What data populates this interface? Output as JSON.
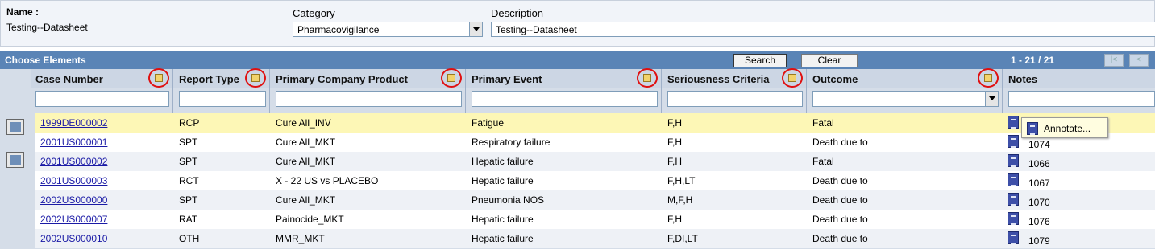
{
  "form": {
    "name_label": "Name :",
    "name_value": "Testing--Datasheet",
    "category_label": "Category",
    "category_value": "Pharmacovigilance",
    "description_label": "Description",
    "description_value": "Testing--Datasheet"
  },
  "panel": {
    "title": "Choose Elements",
    "search_label": "Search",
    "clear_label": "Clear",
    "pager": "1 - 21 / 21",
    "first_label": "|<",
    "prev_label": "<"
  },
  "columns": [
    "Case Number",
    "Report Type",
    "Primary Company Product",
    "Primary Event",
    "Seriousness Criteria",
    "Outcome",
    "Notes"
  ],
  "rows": [
    {
      "case": "1999DE000002",
      "type": "RCP",
      "product": "Cure All_INV",
      "event": "Fatigue",
      "serious": "F,H",
      "outcome": "Fatal",
      "notes": ""
    },
    {
      "case": "2001US000001",
      "type": "SPT",
      "product": "Cure All_MKT",
      "event": "Respiratory failure",
      "serious": "F,H",
      "outcome": "Death due to",
      "notes": "1074"
    },
    {
      "case": "2001US000002",
      "type": "SPT",
      "product": "Cure All_MKT",
      "event": "Hepatic failure",
      "serious": "F,H",
      "outcome": "Fatal",
      "notes": "1066"
    },
    {
      "case": "2001US000003",
      "type": "RCT",
      "product": "X - 22 US vs PLACEBO",
      "event": "Hepatic failure",
      "serious": "F,H,LT",
      "outcome": "Death due to",
      "notes": "1067"
    },
    {
      "case": "2002US000000",
      "type": "SPT",
      "product": "Cure All_MKT",
      "event": "Pneumonia NOS",
      "serious": "M,F,H",
      "outcome": "Death due to",
      "notes": "1070"
    },
    {
      "case": "2002US000007",
      "type": "RAT",
      "product": "Painocide_MKT",
      "event": "Hepatic failure",
      "serious": "F,H",
      "outcome": "Death due to",
      "notes": "1076"
    },
    {
      "case": "2002US000010",
      "type": "OTH",
      "product": "MMR_MKT",
      "event": "Hepatic failure",
      "serious": "F,DI,LT",
      "outcome": "Death due to",
      "notes": "1079"
    }
  ],
  "popup": {
    "label": "Annotate..."
  },
  "colors": {
    "titlebar": "#5a84b6",
    "highlight_row": "#fdf7b6",
    "link": "#1a1aa6",
    "sort_circle": "#e01010"
  }
}
